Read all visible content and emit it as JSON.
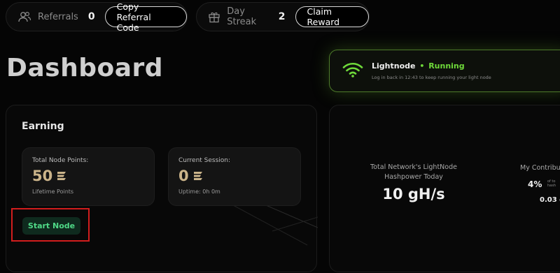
{
  "topbar": {
    "referrals": {
      "label": "Referrals",
      "count": "0",
      "button": "Copy Referral Code",
      "icon": "users-icon"
    },
    "streak": {
      "label": "Day Streak",
      "count": "2",
      "button": "Claim Reward",
      "icon": "gift-icon"
    }
  },
  "page_title": "Dashboard",
  "status": {
    "name": "Lightnode",
    "dot": "•",
    "state": "Running",
    "message": "Log in back in 12:43 to keep running your light node",
    "icon": "wifi-icon",
    "accent": "#6fda3a"
  },
  "earning": {
    "heading": "Earning",
    "total": {
      "label": "Total Node Points:",
      "value": "50",
      "sub": "Lifetime Points"
    },
    "session": {
      "label": "Current Session:",
      "value": "0",
      "sub": "Uptime: 0h 0m"
    },
    "start_button": "Start Node",
    "points_color": "#cbb48a"
  },
  "network": {
    "hashpower_label": "Total Network's LightNode Hashpower Today",
    "hashpower_value": "10 gH/s",
    "contribution_label": "My Contribu",
    "contribution_percent": "4%",
    "contribution_sub": "of to\nhash",
    "contribution_hash": "0.03 g"
  }
}
